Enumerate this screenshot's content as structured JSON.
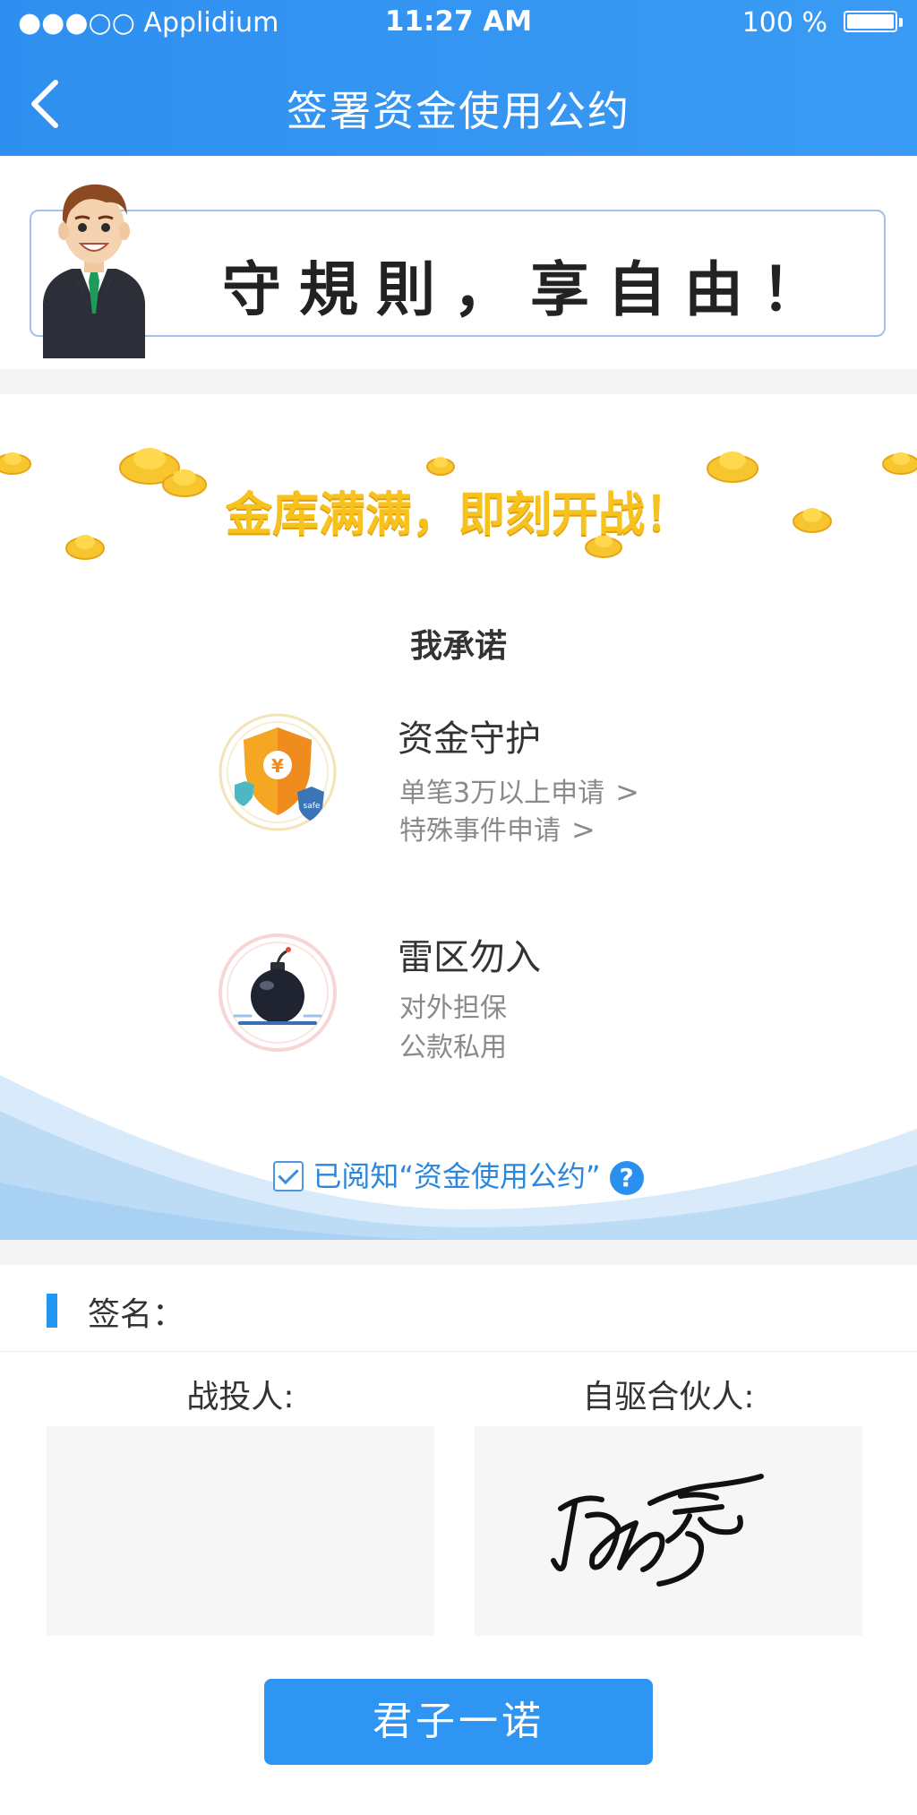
{
  "status_bar": {
    "carrier": "●●●○○ Applidium",
    "time": "11:27 AM",
    "battery": "100 %"
  },
  "header": {
    "title": "签署资金使用公约",
    "back_icon": "chevron-left-icon"
  },
  "banner": {
    "text": "守規則，享自由！"
  },
  "promise": {
    "slogan": "金库满满，即刻开战！",
    "title": "我承诺",
    "items": [
      {
        "icon": "shield-safe-icon",
        "title": "资金守护",
        "lines": [
          "单笔3万以上申请",
          "特殊事件申请"
        ],
        "chevrons": true
      },
      {
        "icon": "bomb-icon",
        "title": "雷区勿入",
        "lines": [
          "对外担保",
          "公款私用"
        ],
        "chevrons": false
      }
    ],
    "acknowledge": "已阅知“资金使用公约”",
    "acknowledge_checked": true,
    "help_symbol": "?"
  },
  "signature": {
    "label": "签名：",
    "parties": [
      {
        "label": "战投人:"
      },
      {
        "label": "自驱合伙人:"
      }
    ]
  },
  "submit": {
    "label": "君子一诺"
  },
  "colors": {
    "primary": "#2e96f2",
    "slogan": "#f6c21b",
    "link": "#2b87dd"
  }
}
